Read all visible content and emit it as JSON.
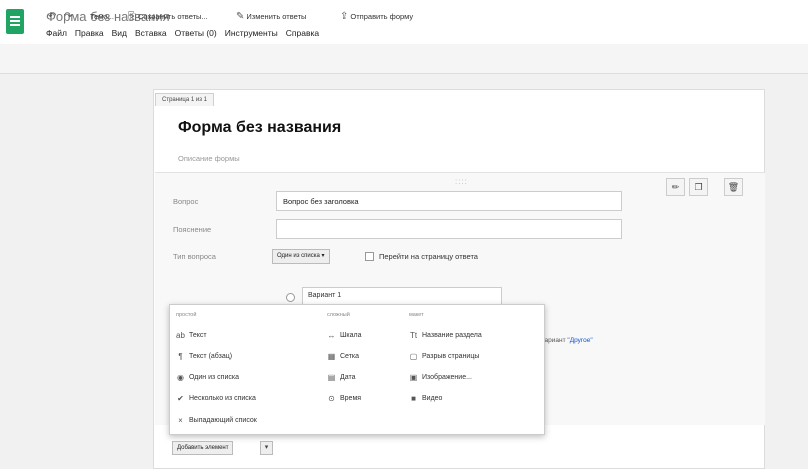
{
  "header": {
    "doc_title": "Форма без названия",
    "menu": [
      "Файл",
      "Правка",
      "Вид",
      "Вставка",
      "Ответы (0)",
      "Инструменты",
      "Справка"
    ]
  },
  "toolbar": {
    "theme_label": "Тема...",
    "save_answers_label": "Сохранить ответы...",
    "edit_answers_label": "Изменить ответы",
    "send_form_label": "Отправить форму"
  },
  "form": {
    "page_tab": "Страница 1 из 1",
    "title": "Форма без названия",
    "description_placeholder": "Описание формы"
  },
  "question": {
    "question_label": "Вопрос",
    "question_value": "Вопрос без заголовка",
    "hint_label": "Пояснение",
    "hint_value": "",
    "type_label": "Тип вопроса",
    "type_value": "Один из списка ▾",
    "goto_label": "Перейти на страницу ответа",
    "option_value": "Вариант 1",
    "other_prefix": "ть вариант ",
    "other_link": "\"Другое\""
  },
  "add_menu": {
    "heading_simple": "простой",
    "heading_complex": "сложный",
    "heading_layout": "макет",
    "simple": [
      {
        "icon": "abc-icon",
        "glyph": "ab",
        "label": "Текст"
      },
      {
        "icon": "paragraph-icon",
        "glyph": "¶",
        "label": "Текст (абзац)"
      },
      {
        "icon": "radio-icon",
        "glyph": "◉",
        "label": "Один из списка"
      },
      {
        "icon": "checkmark-icon",
        "glyph": "✔",
        "label": "Несколько из списка"
      },
      {
        "icon": "list-icon",
        "glyph": "×",
        "label": "Выпадающий список"
      }
    ],
    "complex": [
      {
        "icon": "scale-icon",
        "glyph": "↔",
        "label": "Шкала"
      },
      {
        "icon": "grid-icon",
        "glyph": "▦",
        "label": "Сетка"
      },
      {
        "icon": "calendar-icon",
        "glyph": "▤",
        "label": "Дата"
      },
      {
        "icon": "clock-icon",
        "glyph": "⊙",
        "label": "Время"
      }
    ],
    "layout": [
      {
        "icon": "section-header-icon",
        "glyph": "Tt",
        "label": "Название раздела"
      },
      {
        "icon": "page-break-icon",
        "glyph": "▢",
        "label": "Разрыв страницы"
      },
      {
        "icon": "image-icon",
        "glyph": "▣",
        "label": "Изображение..."
      },
      {
        "icon": "video-icon",
        "glyph": "■",
        "label": "Видео"
      }
    ]
  },
  "add_element": {
    "label": "Добавить элемент",
    "arrow": "▾"
  },
  "colors": {
    "app_green": "#1fa463",
    "link_blue": "#1155cc"
  }
}
